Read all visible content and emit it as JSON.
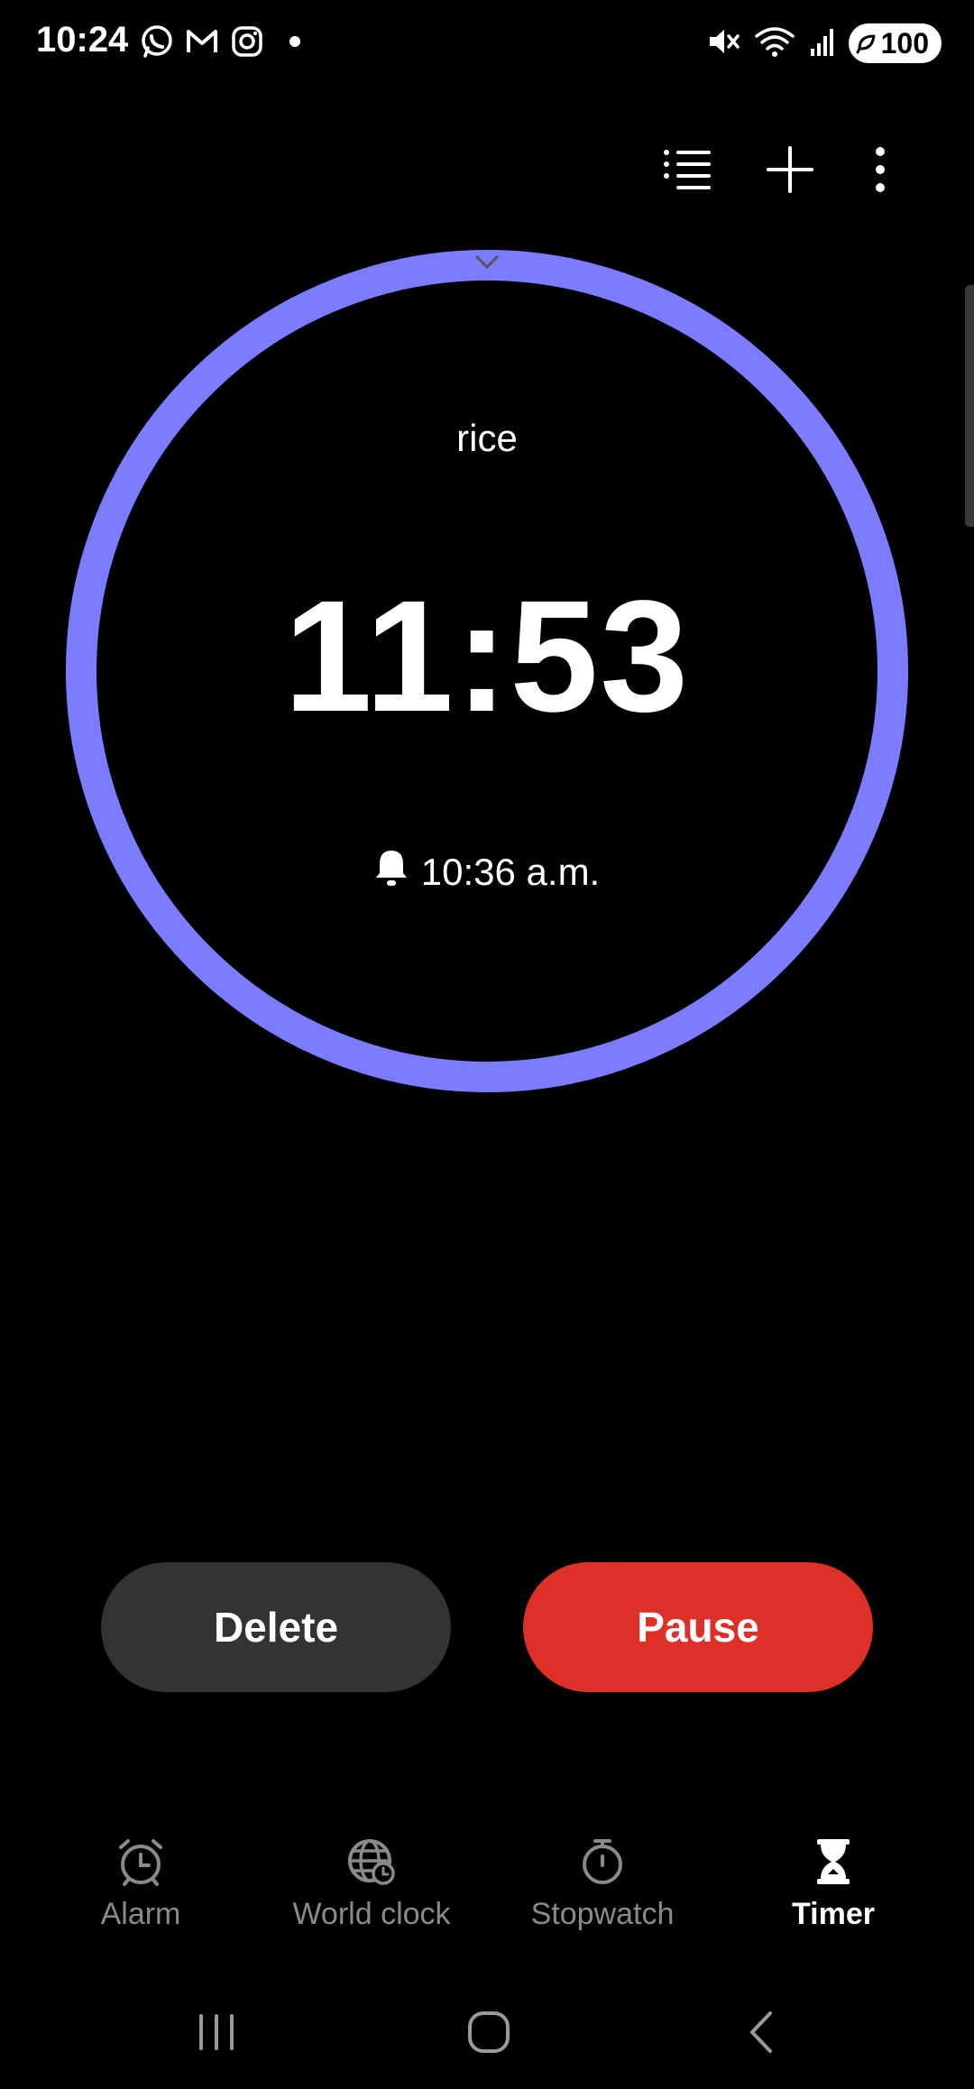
{
  "status_bar": {
    "time": "10:24",
    "battery": "100",
    "notification_icons": [
      "whatsapp-icon",
      "gmail-icon",
      "instagram-icon",
      "more-notifications-dot"
    ],
    "system_icons": [
      "mute-icon",
      "wifi-icon",
      "signal-icon",
      "battery-icon"
    ]
  },
  "toolbar": {
    "icons": [
      "list-icon",
      "add-icon",
      "more-vert-icon"
    ]
  },
  "timer": {
    "label": "rice",
    "remaining": "11:53",
    "end_time": "10:36 a.m.",
    "progress_fraction": 1.0,
    "ring_color": "#7b7cff"
  },
  "actions": {
    "delete_label": "Delete",
    "pause_label": "Pause",
    "pause_color": "#dd3028"
  },
  "bottom_nav": {
    "items": [
      {
        "label": "Alarm",
        "icon": "alarm-icon",
        "active": false
      },
      {
        "label": "World clock",
        "icon": "globe-icon",
        "active": false
      },
      {
        "label": "Stopwatch",
        "icon": "stopwatch-icon",
        "active": false
      },
      {
        "label": "Timer",
        "icon": "hourglass-icon",
        "active": true
      }
    ]
  },
  "system_nav": {
    "icons": [
      "recents-icon",
      "home-icon",
      "back-icon"
    ]
  }
}
